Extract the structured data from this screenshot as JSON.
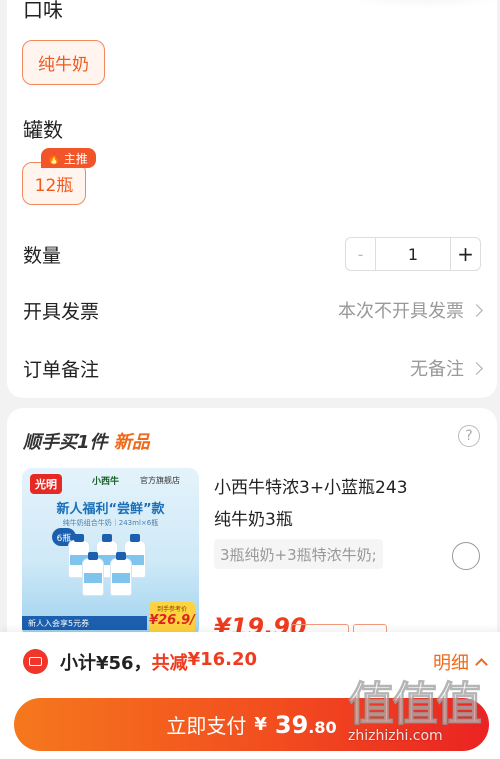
{
  "options": {
    "flavor": {
      "title": "口味",
      "selected": "纯牛奶"
    },
    "count": {
      "title": "罐数",
      "tag": "主推",
      "selected": "12瓶"
    }
  },
  "quantity": {
    "label": "数量",
    "minus": "-",
    "value": "1",
    "plus": "+"
  },
  "invoice": {
    "label": "开具发票",
    "value": "本次不开具发票"
  },
  "remark": {
    "label": "订单备注",
    "value": "无备注"
  },
  "add_on": {
    "title": "顺手买1件",
    "title_new": "新品",
    "product": {
      "name": "小西牛特浓3+小蓝瓶243纯牛奶3瓶",
      "spec": "3瓶纯奶+3瓶特浓牛奶;",
      "price": "¥19.90",
      "image": {
        "brand": "光明",
        "brand2": "小西牛",
        "store": "官方旗舰店",
        "headline": "新人福利“尝鲜”款",
        "sub": "纯牛奶组合牛奶｜243ml×6瓶",
        "badge": "6瓶",
        "promo": "新人入会享5元券",
        "price_label": "到手参考价",
        "price_value": "¥26.9/件"
      }
    }
  },
  "summary": {
    "subtotal_label": "小计",
    "subtotal_value": "¥56，",
    "discount_label": "共减",
    "discount_value": "¥16.20",
    "detail": "明细"
  },
  "pay": {
    "label": "立即支付",
    "currency": "¥",
    "int": "39",
    "dec": ".80"
  },
  "watermark": {
    "big": "值值值",
    "small": "zhizhizhi.com"
  },
  "colors": {
    "accent": "#ef5a1f",
    "price_red": "#ef3b1f",
    "button_start": "#f5781d",
    "button_end": "#ea2323"
  }
}
